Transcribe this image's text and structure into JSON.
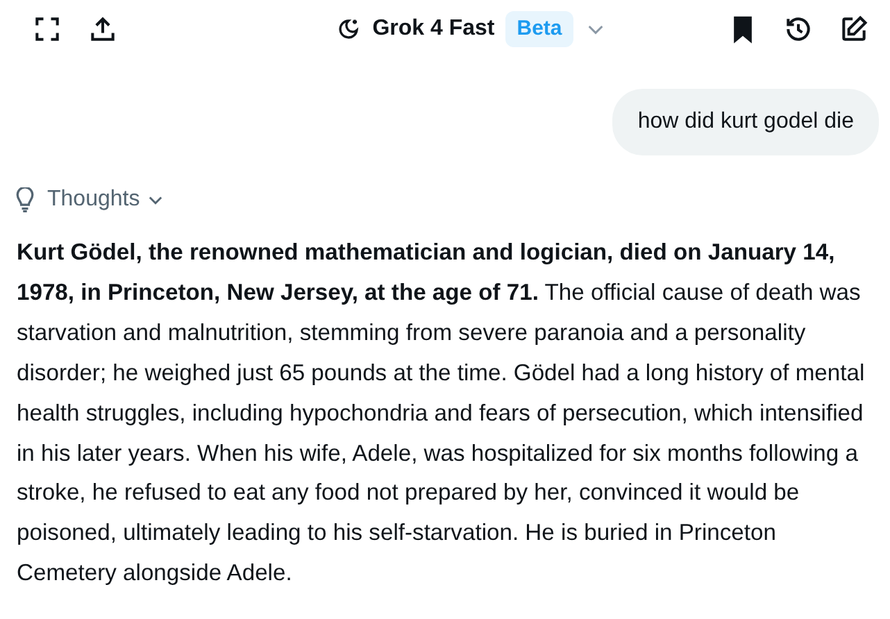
{
  "header": {
    "model": "Grok 4 Fast",
    "badge": "Beta",
    "bookmarked": true
  },
  "user_message": "how did kurt godel die",
  "thoughts": {
    "label": "Thoughts",
    "expanded": false
  },
  "answer": "**Kurt Gödel, the renowned mathematician and logician, died on January 14, 1978, in Princeton, New Jersey, at the age of 71.** The official cause of death was starvation and malnutrition, stemming from severe paranoia and a personality disorder; he weighed just 65 pounds at the time. Gödel had a long history of mental health struggles, including hypochondria and fears of persecution, which intensified in his later years. When his wife, Adele, was hospitalized for six months following a stroke, he refused to eat any food not prepared by her, convinced it would be poisoned, ultimately leading to his self-starvation. He is buried in Princeton Cemetery alongside Adele."
}
